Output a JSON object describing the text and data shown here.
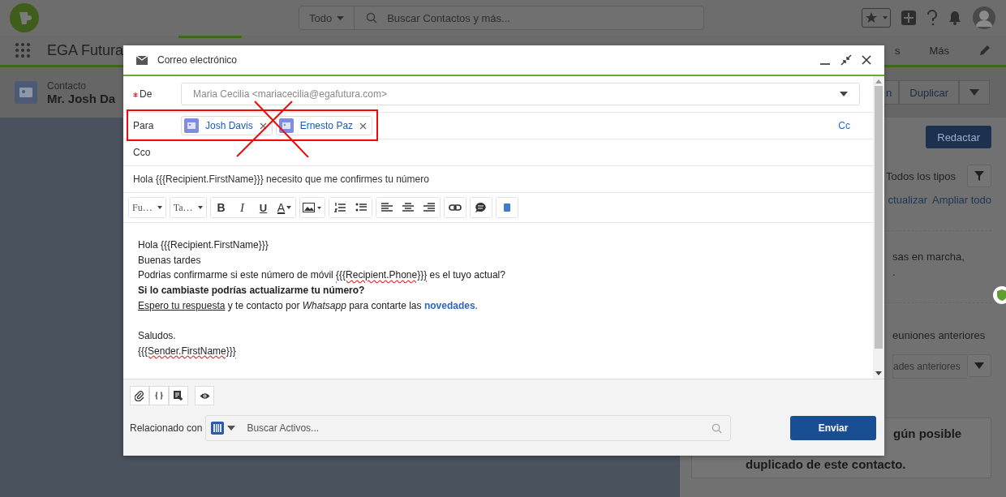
{
  "header": {
    "search_scope": "Todo",
    "search_placeholder": "Buscar Contactos y más..."
  },
  "nav": {
    "app_name": "EGA Futura",
    "items": [
      "s",
      "Más"
    ]
  },
  "record": {
    "type": "Contacto",
    "name": "Mr. Josh Da",
    "actions": [
      "n",
      "Duplicar"
    ]
  },
  "side_panel": {
    "compose_button": "Redactar",
    "filter_label": "Todos los tipos",
    "links": [
      "ctualizar",
      "Ampliar todo"
    ],
    "texts": [
      "sas en marcha,",
      "."
    ],
    "past_heading": "euniones anteriores",
    "past_select": "ades anteriores",
    "duplicate_notice": [
      "gún posible",
      "duplicado de este contacto."
    ]
  },
  "email_dialog": {
    "title": "Correo electrónico",
    "from_label": "De",
    "from_required": true,
    "from_value": "Maria Cecilia <mariacecilia@egafutura.com>",
    "to_label": "Para",
    "recipients": [
      {
        "name": "Josh Davis"
      },
      {
        "name": "Ernesto Paz"
      }
    ],
    "cc_link": "Cc",
    "bcc_label": "Cco",
    "subject": "Hola {{{Recipient.FirstName}}} necesito que me confirmes tu número",
    "toolbar": {
      "font": "Fu…",
      "size": "Ta…",
      "bold": "B",
      "italic": "I",
      "underline": "U",
      "text_color": "A"
    },
    "body": [
      {
        "kind": "text",
        "segments": [
          {
            "text": "Hola {{{Recipient.FirstName}}}",
            "kind": "plain"
          }
        ]
      },
      {
        "kind": "text",
        "segments": [
          {
            "text": "Buenas tardes",
            "kind": "plain"
          }
        ]
      },
      {
        "kind": "text",
        "segments": [
          {
            "text": "Podrias confirmarme si este número de móvil ",
            "kind": "plain"
          },
          {
            "text": "{{{Recipient.Phone}}}",
            "kind": "misspelled"
          },
          {
            "text": " es el tuyo actual?",
            "kind": "plain"
          }
        ]
      },
      {
        "kind": "text",
        "segments": [
          {
            "text": "Si lo cambiaste podrías actualizarme tu número?",
            "kind": "bold"
          }
        ]
      },
      {
        "kind": "text",
        "segments": [
          {
            "text": "Espero tu respuesta",
            "kind": "underline"
          },
          {
            "text": " y te contacto por ",
            "kind": "plain"
          },
          {
            "text": "Whatsapp",
            "kind": "italic"
          },
          {
            "text": " para contarte las ",
            "kind": "plain"
          },
          {
            "text": "novedades",
            "kind": "link"
          },
          {
            "text": ".",
            "kind": "plain"
          }
        ]
      },
      {
        "kind": "blank"
      },
      {
        "kind": "text",
        "segments": [
          {
            "text": "Saludos.",
            "kind": "plain"
          }
        ]
      },
      {
        "kind": "text",
        "segments": [
          {
            "text": "{{{Sender.FirstName}}}",
            "kind": "misspelled"
          }
        ]
      }
    ],
    "related_label": "Relacionado con",
    "related_placeholder": "Buscar Activos...",
    "send_button": "Enviar"
  }
}
